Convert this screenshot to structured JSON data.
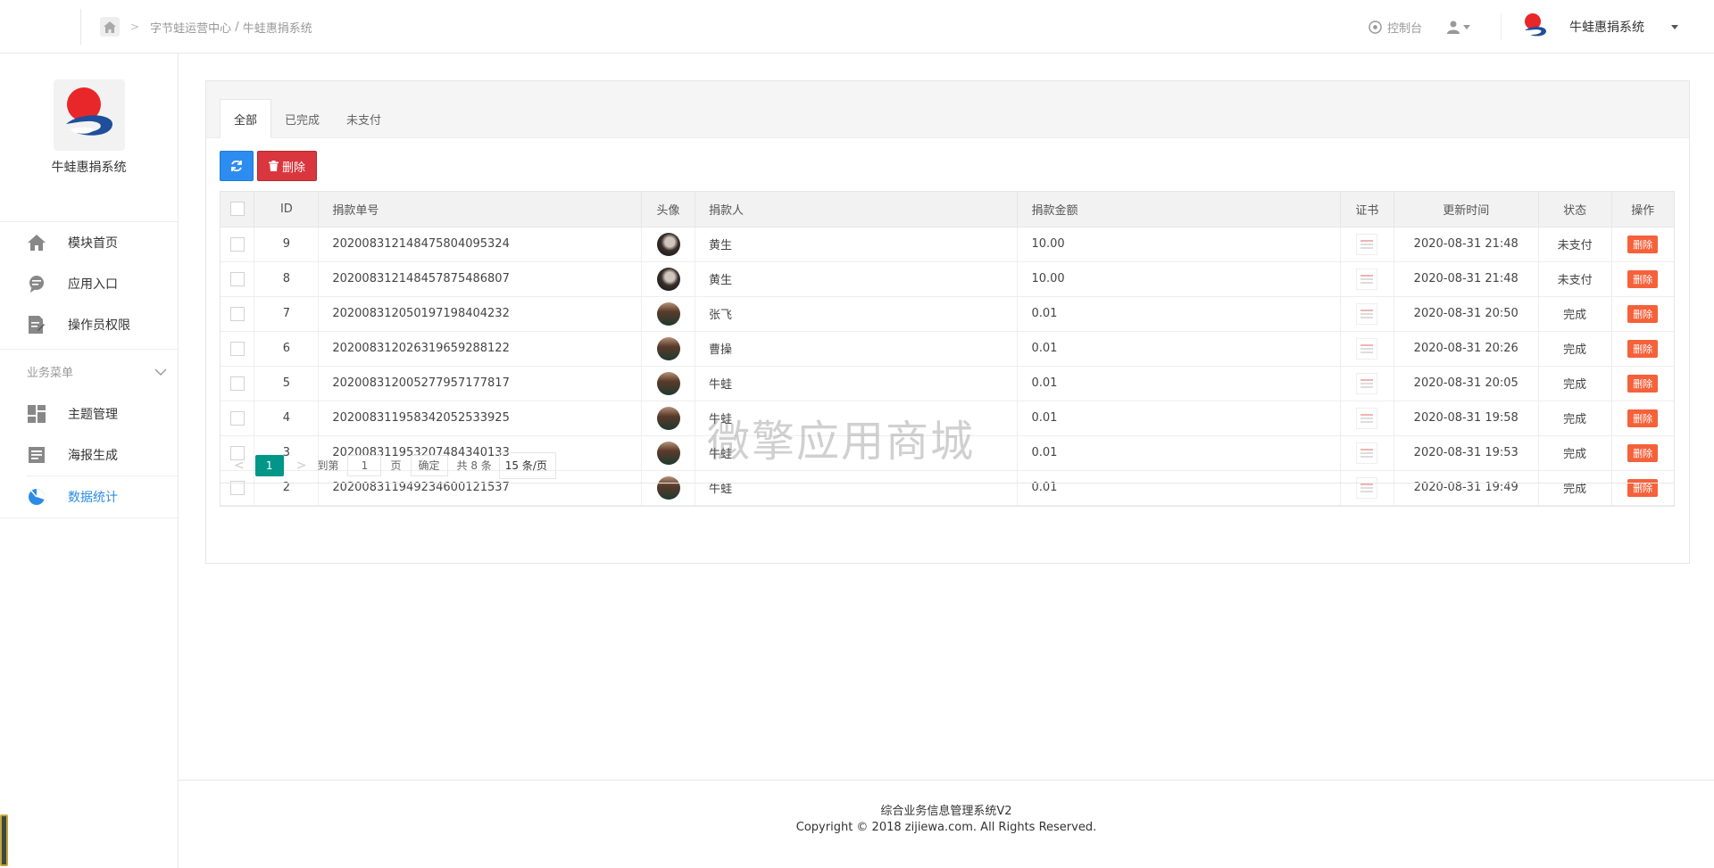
{
  "header": {
    "breadcrumb": [
      "字节蛙运营中心",
      "牛蛙惠捐系统"
    ],
    "breadcrumb_sep": "/",
    "console_label": "控制台",
    "user_name": "牛蛙惠捐系统"
  },
  "sidebar": {
    "brand_name": "牛蛙惠捐系统",
    "top_items": [
      {
        "label": "模块首页",
        "icon": "home-icon"
      },
      {
        "label": "应用入口",
        "icon": "chat-bubble-icon"
      },
      {
        "label": "操作员权限",
        "icon": "document-edit-icon"
      }
    ],
    "group_label": "业务菜单",
    "group_items": [
      {
        "label": "主题管理",
        "icon": "dashboard-grid-icon"
      },
      {
        "label": "海报生成",
        "icon": "list-doc-icon"
      },
      {
        "label": "数据统计",
        "icon": "pie-chart-icon",
        "active": true
      }
    ]
  },
  "tabs": [
    "全部",
    "已完成",
    "未支付"
  ],
  "toolbar": {
    "delete_label": "删除"
  },
  "table": {
    "columns": [
      "ID",
      "捐款单号",
      "头像",
      "捐款人",
      "捐款金额",
      "证书",
      "更新时间",
      "状态",
      "操作"
    ],
    "rows": [
      {
        "id": "9",
        "order": "20200831214847580409532 4",
        "donor": "黄生",
        "amount": "10.00",
        "time": "2020-08-31 21:48",
        "status": "未支付",
        "action": "删除",
        "avatar": "a"
      },
      {
        "id": "8",
        "order": "2020083121484578754868 07",
        "donor": "黄生",
        "amount": "10.00",
        "time": "2020-08-31 21:48",
        "status": "未支付",
        "action": "删除",
        "avatar": "a"
      },
      {
        "id": "7",
        "order": "2020083120501971984042 32",
        "donor": "张飞",
        "amount": "0.01",
        "time": "2020-08-31 20:50",
        "status": "完成",
        "action": "删除",
        "avatar": "b"
      },
      {
        "id": "6",
        "order": "2020083120263196592881 22",
        "donor": "曹操",
        "amount": "0.01",
        "time": "2020-08-31 20:26",
        "status": "完成",
        "action": "删除",
        "avatar": "b"
      },
      {
        "id": "5",
        "order": "2020083120052779571778 17",
        "donor": "牛蛙",
        "amount": "0.01",
        "time": "2020-08-31 20:05",
        "status": "完成",
        "action": "删除",
        "avatar": "b"
      },
      {
        "id": "4",
        "order": "2020083119583420525339 25",
        "donor": "牛蛙",
        "amount": "0.01",
        "time": "2020-08-31 19:58",
        "status": "完成",
        "action": "删除",
        "avatar": "b"
      },
      {
        "id": "3",
        "order": "2020083119532074843401 33",
        "donor": "牛蛙",
        "amount": "0.01",
        "time": "2020-08-31 19:53",
        "status": "完成",
        "action": "删除",
        "avatar": "b"
      },
      {
        "id": "2",
        "order": "2020083119492346001215 37",
        "donor": "牛蛙",
        "amount": "0.01",
        "time": "2020-08-31 19:49",
        "status": "完成",
        "action": "删除",
        "avatar": "b"
      }
    ]
  },
  "pager": {
    "current": "1",
    "goto_prefix": "到第",
    "goto_value": "1",
    "goto_suffix": "页",
    "confirm": "确定",
    "total": "共 8 条",
    "page_size": "15 条/页"
  },
  "watermark": "微擎应用商城",
  "footer": {
    "line1": "综合业务信息管理系统V2",
    "line2": "Copyright © 2018 zijiewa.com. All Rights Reserved."
  }
}
